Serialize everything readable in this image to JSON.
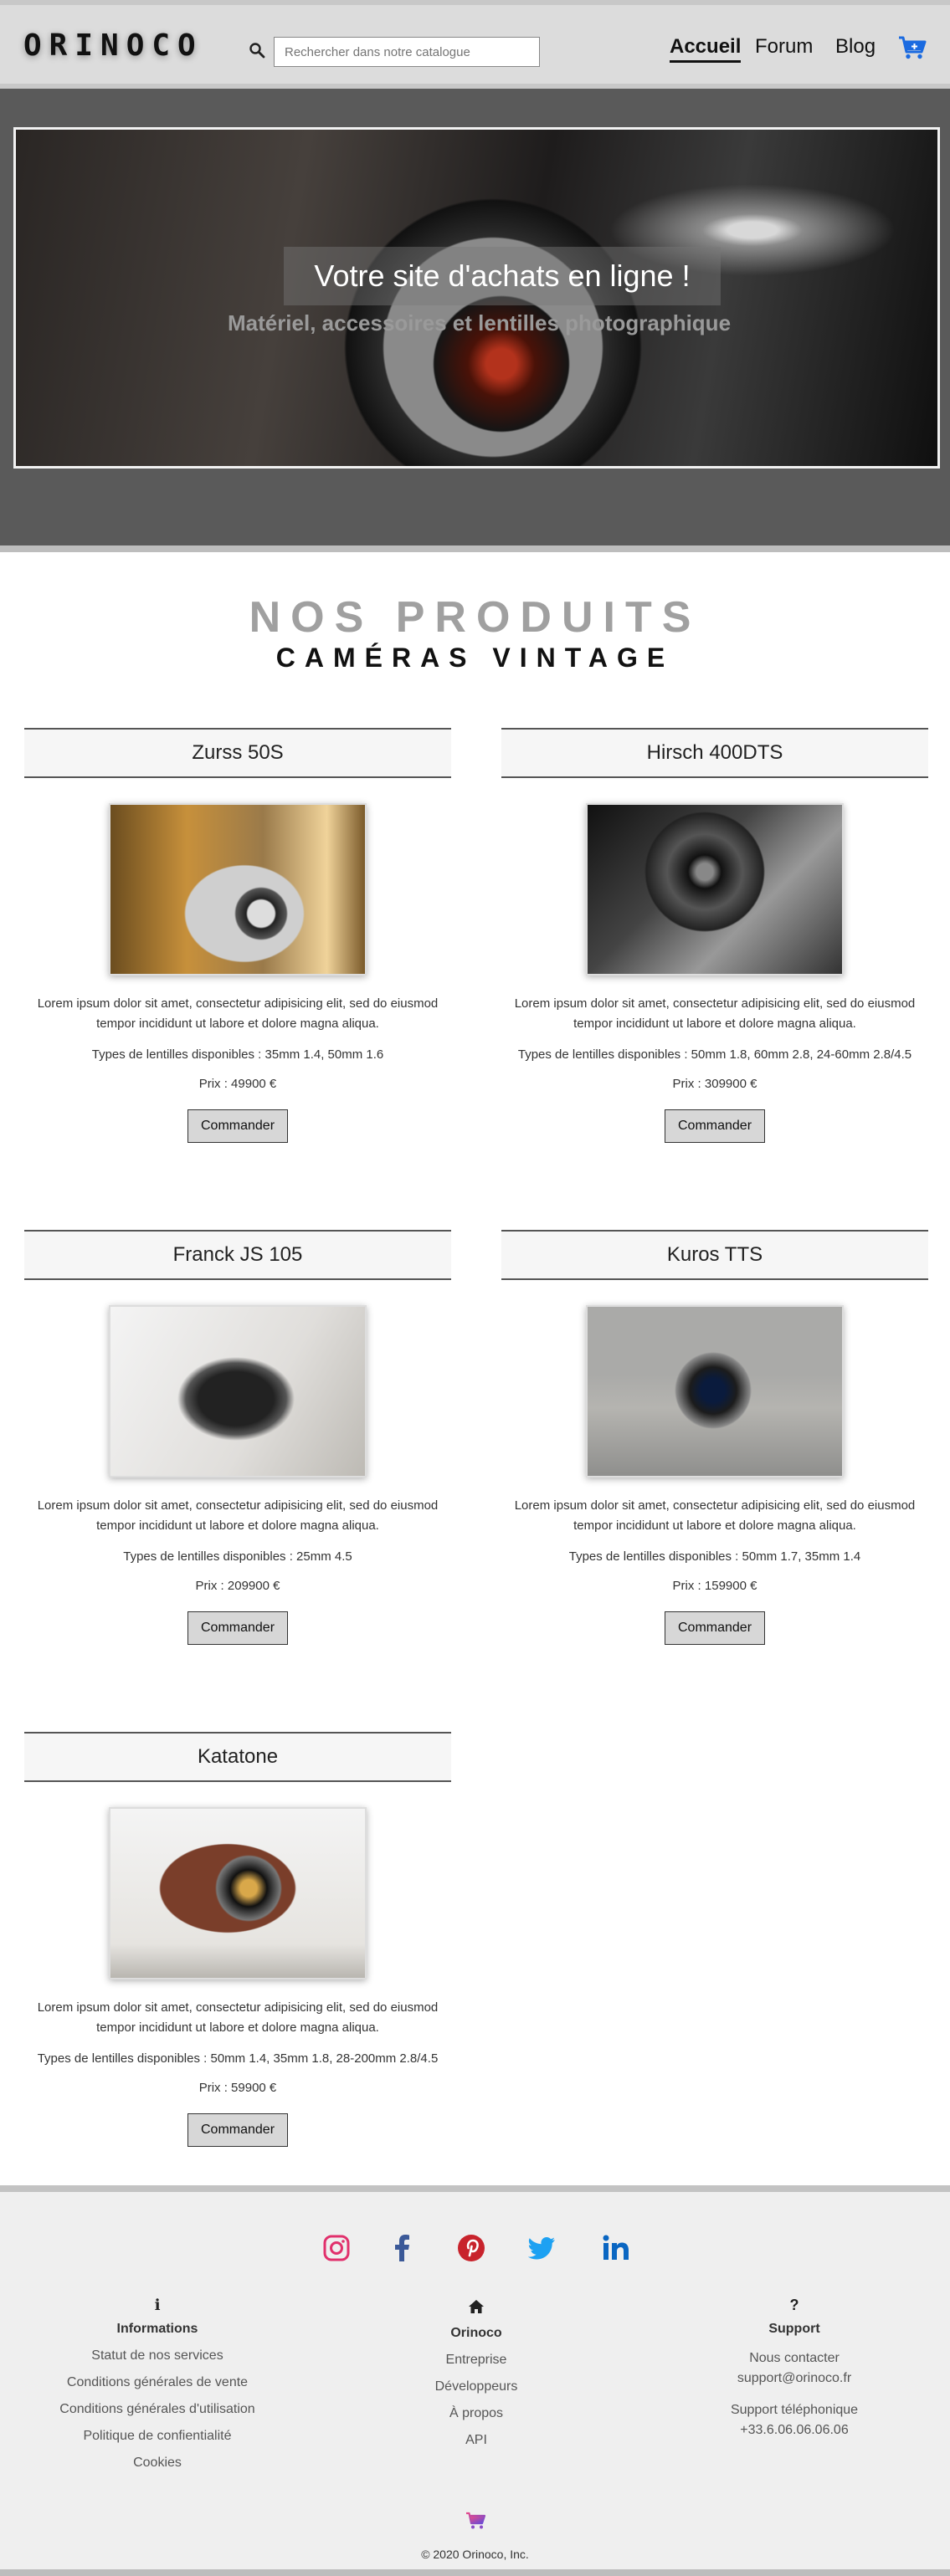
{
  "header": {
    "logo": "ORINOCO",
    "search_placeholder": "Rechercher dans notre catalogue",
    "nav": {
      "home": "Accueil",
      "forum": "Forum",
      "blog": "Blog"
    }
  },
  "hero": {
    "title": "Votre site d'achats en ligne !",
    "subtitle": "Matériel, accessoires et lentilles photographique"
  },
  "products_section": {
    "title": "NOS PRODUITS",
    "subtitle": "CAMÉRAS VINTAGE",
    "order_label": "Commander",
    "items": [
      {
        "name": "Zurss 50S",
        "description": "Lorem ipsum dolor sit amet, consectetur adipisicing elit, sed do eiusmod tempor incididunt ut labore et dolore magna aliqua.",
        "lenses": "Types de lentilles disponibles : 35mm 1.4, 50mm 1.6",
        "price": "Prix : 49900 €"
      },
      {
        "name": "Hirsch 400DTS",
        "description": "Lorem ipsum dolor sit amet, consectetur adipisicing elit, sed do eiusmod tempor incididunt ut labore et dolore magna aliqua.",
        "lenses": "Types de lentilles disponibles : 50mm 1.8, 60mm 2.8, 24-60mm 2.8/4.5",
        "price": "Prix : 309900 €"
      },
      {
        "name": "Franck JS 105",
        "description": "Lorem ipsum dolor sit amet, consectetur adipisicing elit, sed do eiusmod tempor incididunt ut labore et dolore magna aliqua.",
        "lenses": "Types de lentilles disponibles : 25mm 4.5",
        "price": "Prix : 209900 €"
      },
      {
        "name": "Kuros TTS",
        "description": "Lorem ipsum dolor sit amet, consectetur adipisicing elit, sed do eiusmod tempor incididunt ut labore et dolore magna aliqua.",
        "lenses": "Types de lentilles disponibles : 50mm 1.7, 35mm 1.4",
        "price": "Prix : 159900 €"
      },
      {
        "name": "Katatone",
        "description": "Lorem ipsum dolor sit amet, consectetur adipisicing elit, sed do eiusmod tempor incididunt ut labore et dolore magna aliqua.",
        "lenses": "Types de lentilles disponibles : 50mm 1.4, 35mm 1.8, 28-200mm 2.8/4.5",
        "price": "Prix : 59900 €"
      }
    ]
  },
  "footer": {
    "social_icons": [
      "instagram-icon",
      "facebook-icon",
      "pinterest-icon",
      "twitter-icon",
      "linkedin-icon"
    ],
    "informations": {
      "title": "Informations",
      "links": [
        "Statut de nos services",
        "Conditions générales de vente",
        "Conditions générales d'utilisation",
        "Politique de confientialité",
        "Cookies"
      ]
    },
    "orinoco": {
      "title": "Orinoco",
      "links": [
        "Entreprise",
        "Développeurs",
        "À propos",
        "API"
      ]
    },
    "support": {
      "title": "Support",
      "contact_label": "Nous contacter",
      "email": "support@orinoco.fr",
      "phone_label": "Support téléphonique",
      "phone": "+33.6.06.06.06.06"
    },
    "copyright": "© 2020 Orinoco, Inc."
  },
  "colors": {
    "accent_blue": "#1a6ae0",
    "instagram": "#e1306c",
    "facebook": "#3b5998",
    "pinterest": "#c8232c",
    "twitter": "#1da1f2",
    "linkedin": "#0a66c2"
  }
}
